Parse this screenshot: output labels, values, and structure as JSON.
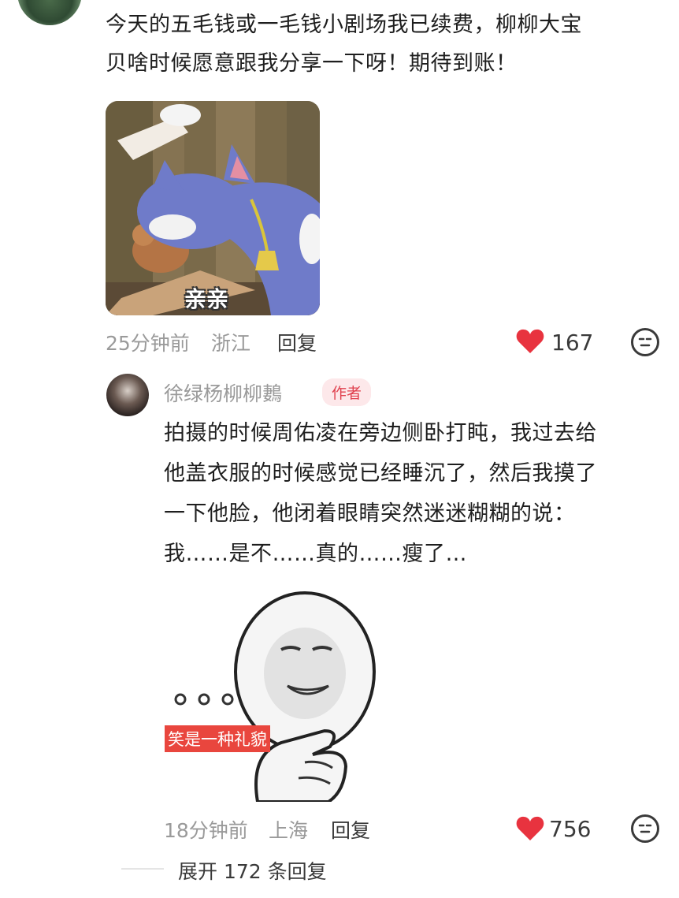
{
  "top_comment": {
    "text_line1": "今天的五毛钱或一毛钱小剧场我已续费，柳柳大宝",
    "text_line2": "贝啥时候愿意跟我分享一下呀！期待到账！",
    "sticker_caption": "亲亲",
    "time": "25分钟前",
    "location": "浙江",
    "reply_label": "回复",
    "likes": "167"
  },
  "reply": {
    "author": "徐绿杨柳柳鶈",
    "badge": "作者",
    "lines": [
      "拍摄的时候周佑凌在旁边侧卧打盹，我过去给",
      "他盖衣服的时候感觉已经睡沉了，然后我摸了",
      "一下他脸，他闭着眼睛突然迷迷糊糊的说：",
      "我……是不……真的……瘦了…"
    ],
    "sticker_caption": "笑是一种礼貌",
    "time": "18分钟前",
    "location": "上海",
    "reply_label": "回复",
    "likes": "756"
  },
  "expand": {
    "label": "展开 172 条回复"
  },
  "colors": {
    "heart": "#e8333f",
    "badge_bg": "#fde8ea",
    "badge_text": "#e0414e"
  }
}
